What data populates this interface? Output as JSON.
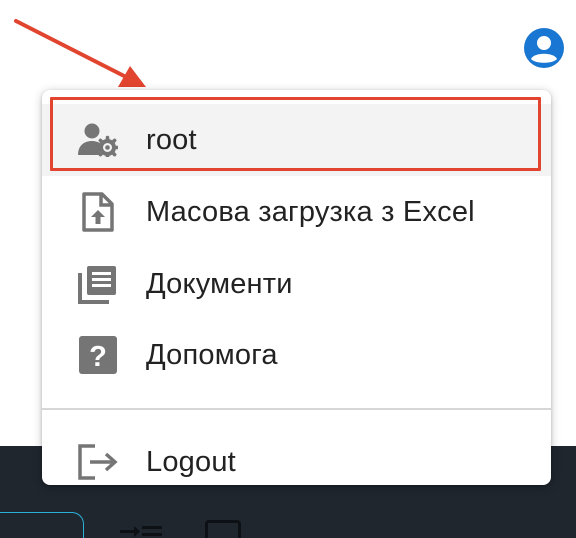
{
  "user_menu": {
    "items": [
      {
        "label": "root",
        "icon": "user-gear-icon"
      },
      {
        "label": "Масова загрузка з Excel",
        "icon": "file-upload-icon"
      },
      {
        "label": "Документи",
        "icon": "library-books-icon"
      },
      {
        "label": "Допомога",
        "icon": "help-box-icon"
      }
    ],
    "logout_label": "Logout",
    "logout_icon": "logout-icon"
  },
  "annotation": {
    "arrow_color": "#e2452f",
    "highlight_color": "#e2452f"
  },
  "header": {
    "avatar_icon": "account-circle-icon",
    "avatar_color": "#1976d2"
  }
}
